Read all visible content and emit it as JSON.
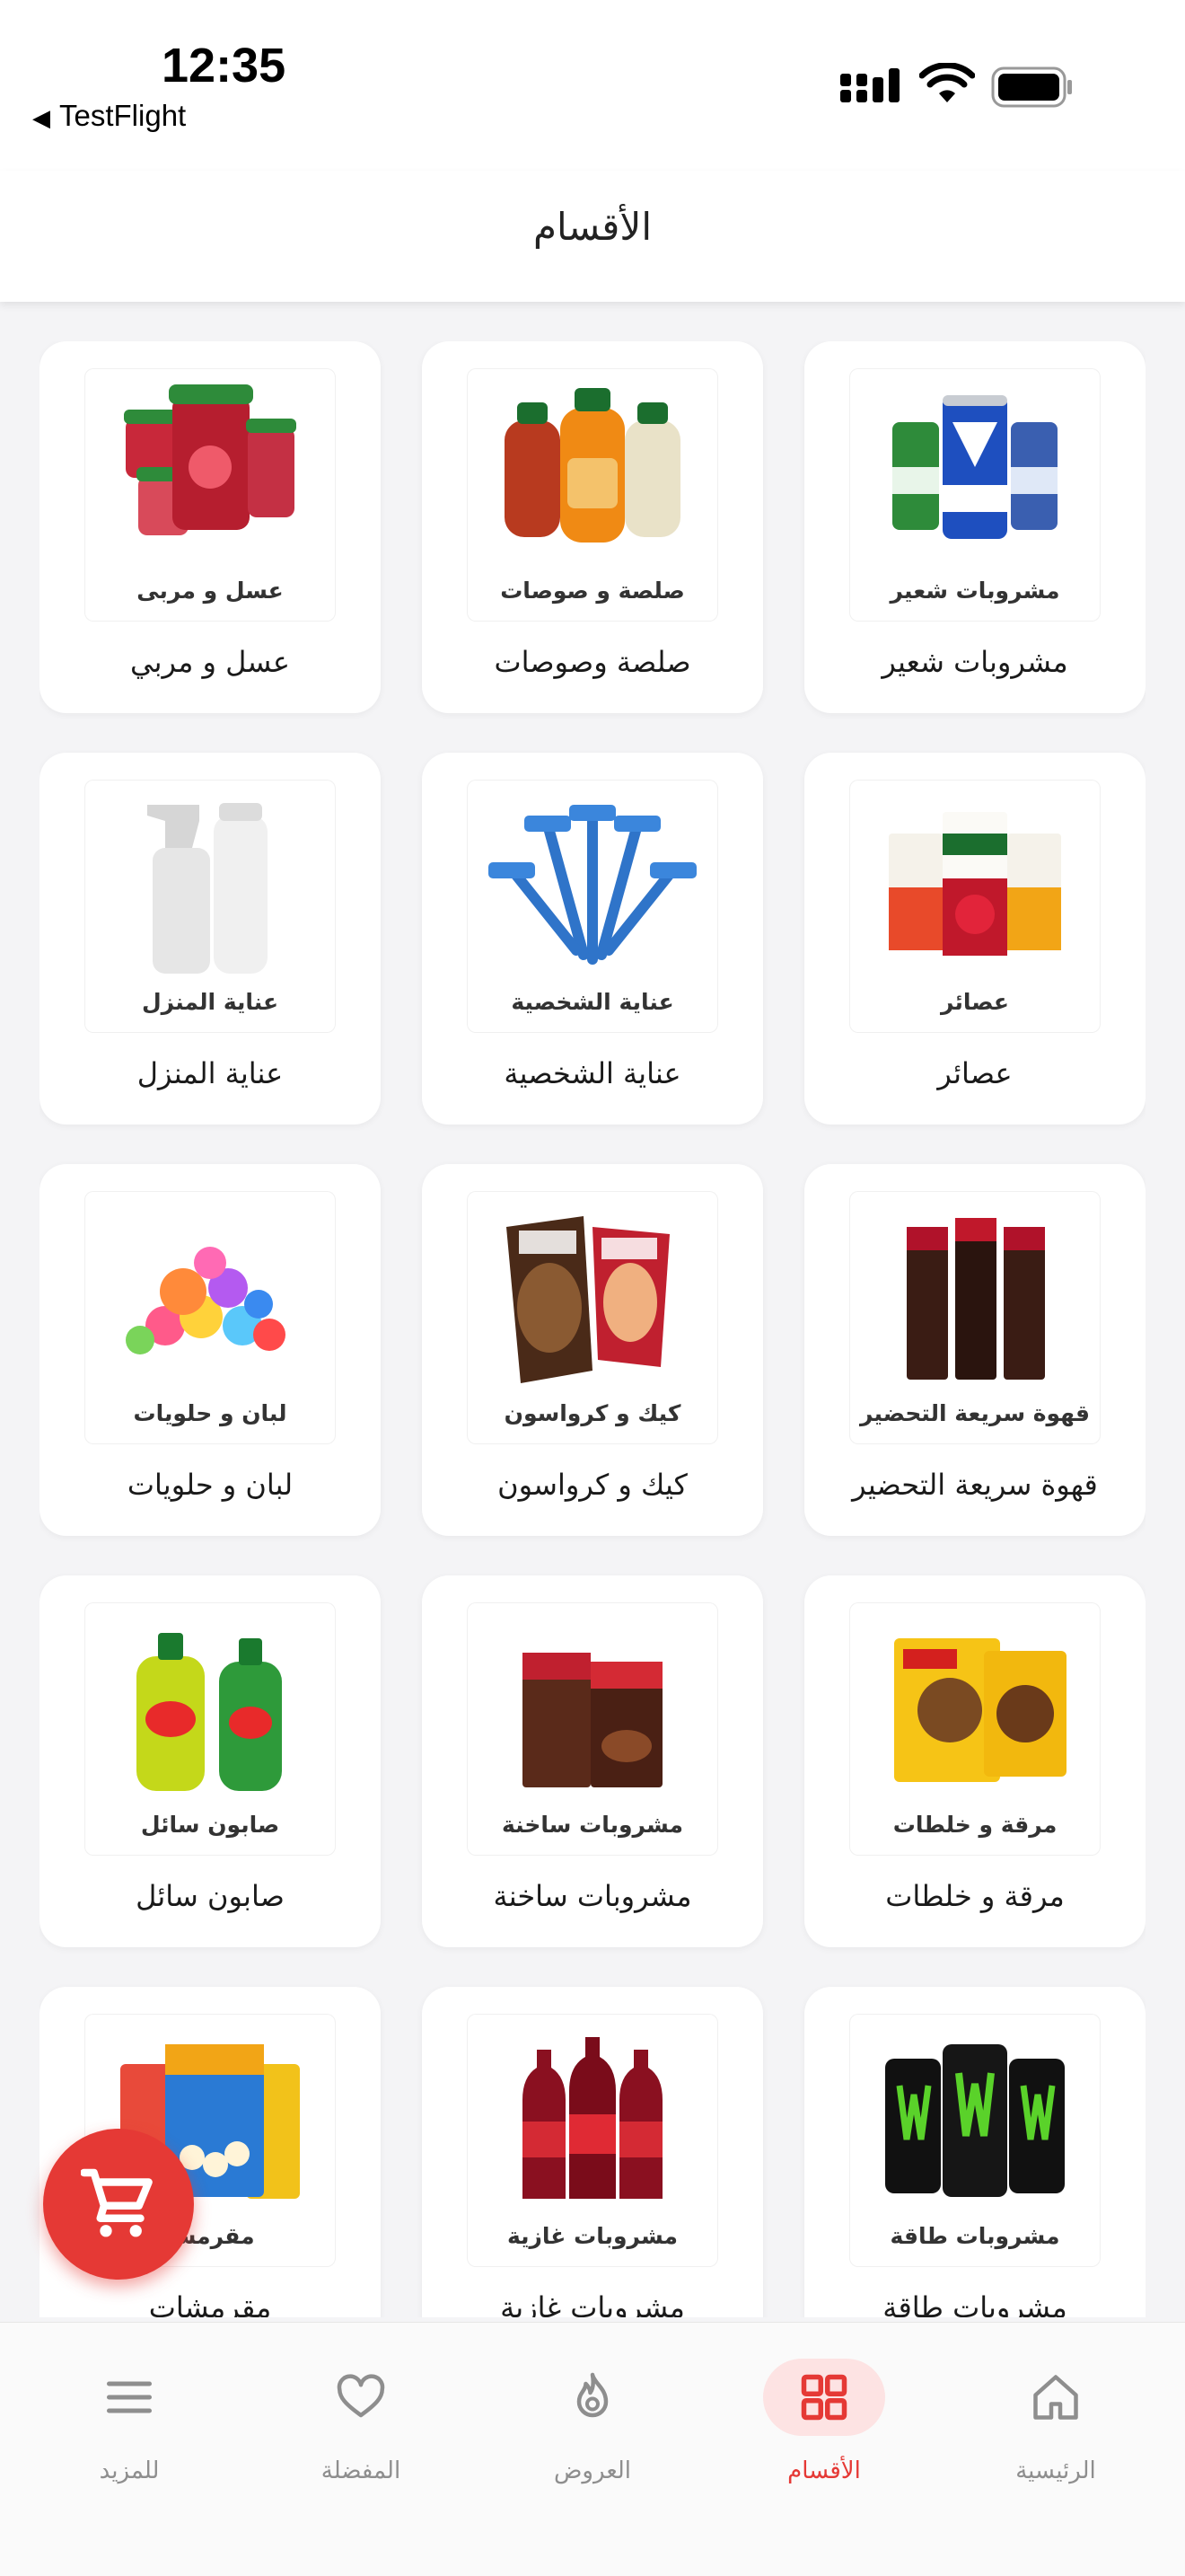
{
  "status": {
    "time": "12:35",
    "back_app": "TestFlight"
  },
  "header": {
    "title": "الأقسام"
  },
  "categories": [
    {
      "name": "مشروبات شعير",
      "thumb_label": "مشروبات شعير",
      "image": "malt-drinks-cans"
    },
    {
      "name": "صلصة وصوصات",
      "thumb_label": "صلصة و صوصات",
      "image": "sauce-bottles"
    },
    {
      "name": "عسل و مربي",
      "thumb_label": "عسل و مربى",
      "image": "jam-jars"
    },
    {
      "name": "عصائر",
      "thumb_label": "عصائر",
      "image": "juice-cartons"
    },
    {
      "name": "عناية الشخصية",
      "thumb_label": "عناية الشخصية",
      "image": "razors"
    },
    {
      "name": "عناية المنزل",
      "thumb_label": "عناية المنزل",
      "image": "spray-bottles"
    },
    {
      "name": "قهوة سريعة التحضير",
      "thumb_label": "قهوة سريعة التحضير",
      "image": "instant-coffee-sticks"
    },
    {
      "name": "كيك و كرواسون",
      "thumb_label": "كيك و كرواسون",
      "image": "croissant-packs"
    },
    {
      "name": "لبان و حلويات",
      "thumb_label": "لبان و حلويات",
      "image": "candies"
    },
    {
      "name": "مرقة و خلطات",
      "thumb_label": "مرقة و خلطات",
      "image": "spice-packs"
    },
    {
      "name": "مشروبات ساخنة",
      "thumb_label": "مشروبات ساخنة",
      "image": "cocoa-boxes"
    },
    {
      "name": "صابون سائل",
      "thumb_label": "صابون سائل",
      "image": "dish-soap-bottles"
    },
    {
      "name": "مشروبات طاقة",
      "thumb_label": "مشروبات طاقة",
      "image": "energy-cans"
    },
    {
      "name": "مشروبات غازية",
      "thumb_label": "مشروبات غازية",
      "image": "soda-bottles"
    },
    {
      "name": "مقرمشات",
      "thumb_label": "مقرمشا",
      "image": "popcorn-bags"
    }
  ],
  "fab": {
    "icon": "cart-icon"
  },
  "tabs": [
    {
      "label": "الرئيسية",
      "icon": "home-icon",
      "active": false
    },
    {
      "label": "الأقسام",
      "icon": "grid-icon",
      "active": true
    },
    {
      "label": "العروض",
      "icon": "flame-icon",
      "active": false
    },
    {
      "label": "المفضلة",
      "icon": "heart-icon",
      "active": false
    },
    {
      "label": "للمزيد",
      "icon": "menu-icon",
      "active": false
    }
  ],
  "colors": {
    "accent": "#e53935",
    "accent_soft": "#fde3e3",
    "background": "#f4f4f6",
    "inactive": "#8e8e8e"
  }
}
